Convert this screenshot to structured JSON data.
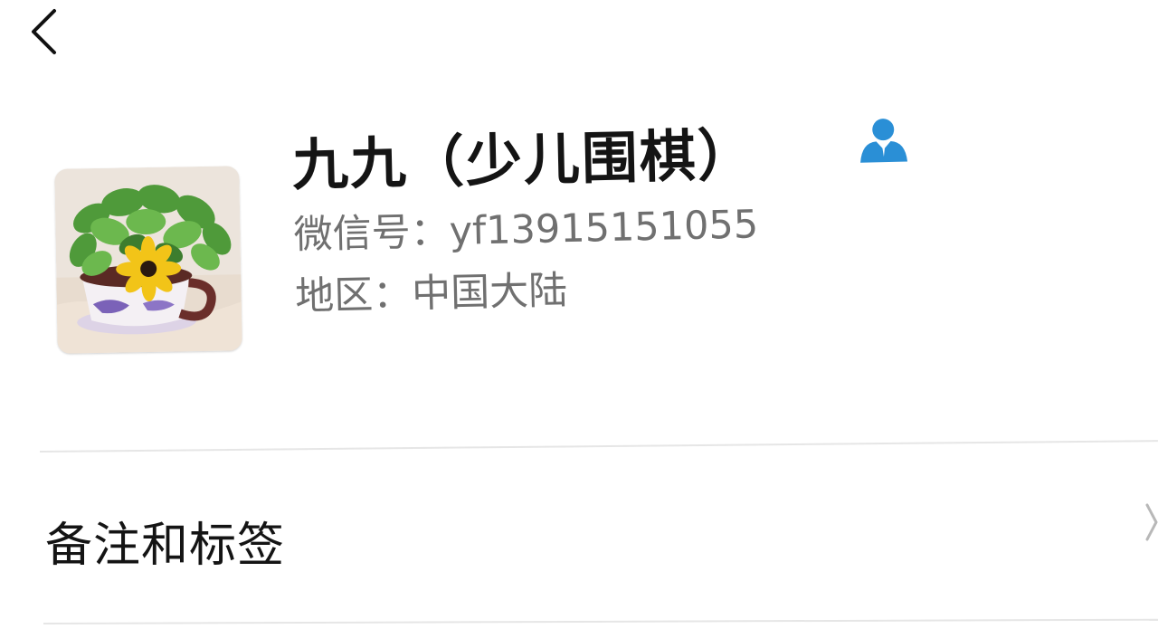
{
  "nav": {
    "back_icon": "chevron-left-icon"
  },
  "profile": {
    "avatar_icon": "potted-plant-photo",
    "nickname": "九九（少儿围棋）",
    "contact_icon": "person-icon",
    "contact_icon_color": "#2a8fd6",
    "wechat_id_label": "微信号：",
    "wechat_id": "yf13915151055",
    "region_label": "地区：",
    "region": "中国大陆"
  },
  "menu": {
    "remarks_label": "备注和标签",
    "chevron_icon": "chevron-right-icon"
  }
}
